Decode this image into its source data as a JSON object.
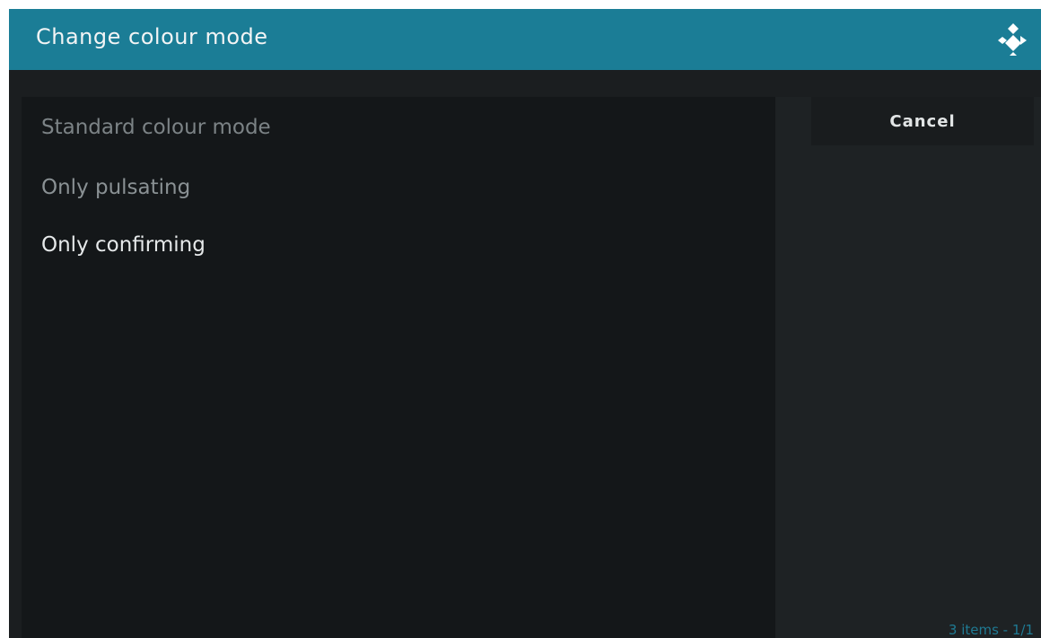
{
  "header": {
    "title": "Change colour mode",
    "logo_icon": "kodi-logo-icon"
  },
  "list": {
    "items": [
      {
        "label": "Standard colour mode"
      },
      {
        "label": "Only pulsating"
      },
      {
        "label": "Only confirming"
      }
    ],
    "focused_index": 2
  },
  "side": {
    "cancel_label": "Cancel",
    "item_count_text": "3 items - 1/1"
  },
  "colors": {
    "header_bg": "#1b7d96",
    "dialog_bg": "#1b1e20",
    "list_bg": "#141719",
    "accent_text": "#1f7a93"
  }
}
